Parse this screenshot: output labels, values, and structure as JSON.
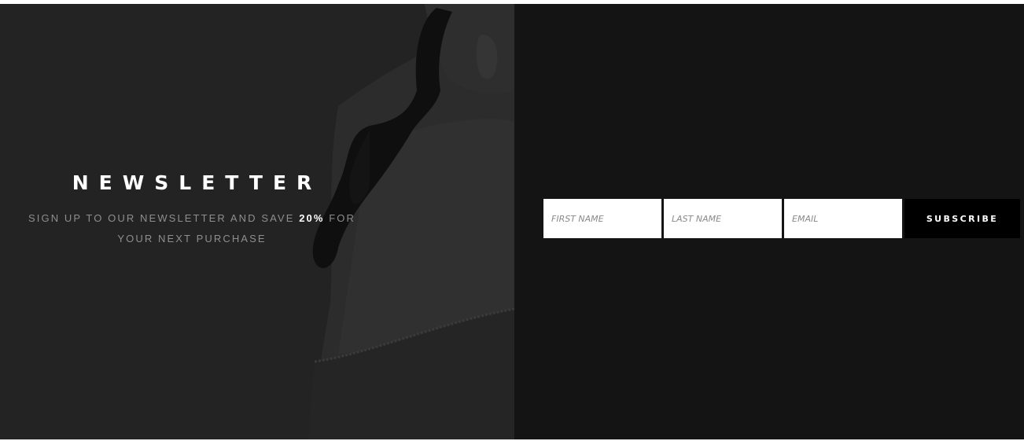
{
  "newsletter": {
    "title": "NEWSLETTER",
    "description_before": "SIGN UP TO OUR NEWSLETTER AND SAVE ",
    "description_highlight": "20%",
    "description_after": " FOR YOUR NEXT PURCHASE"
  },
  "form": {
    "first_name_placeholder": "FIRST NAME",
    "last_name_placeholder": "LAST NAME",
    "email_placeholder": "EMAIL",
    "subscribe_label": "SUBSCRIBE"
  },
  "colors": {
    "panel_background": "#141414",
    "image_tint": "#222223",
    "button_background": "#000000",
    "highlight_text": "#ffffff"
  }
}
